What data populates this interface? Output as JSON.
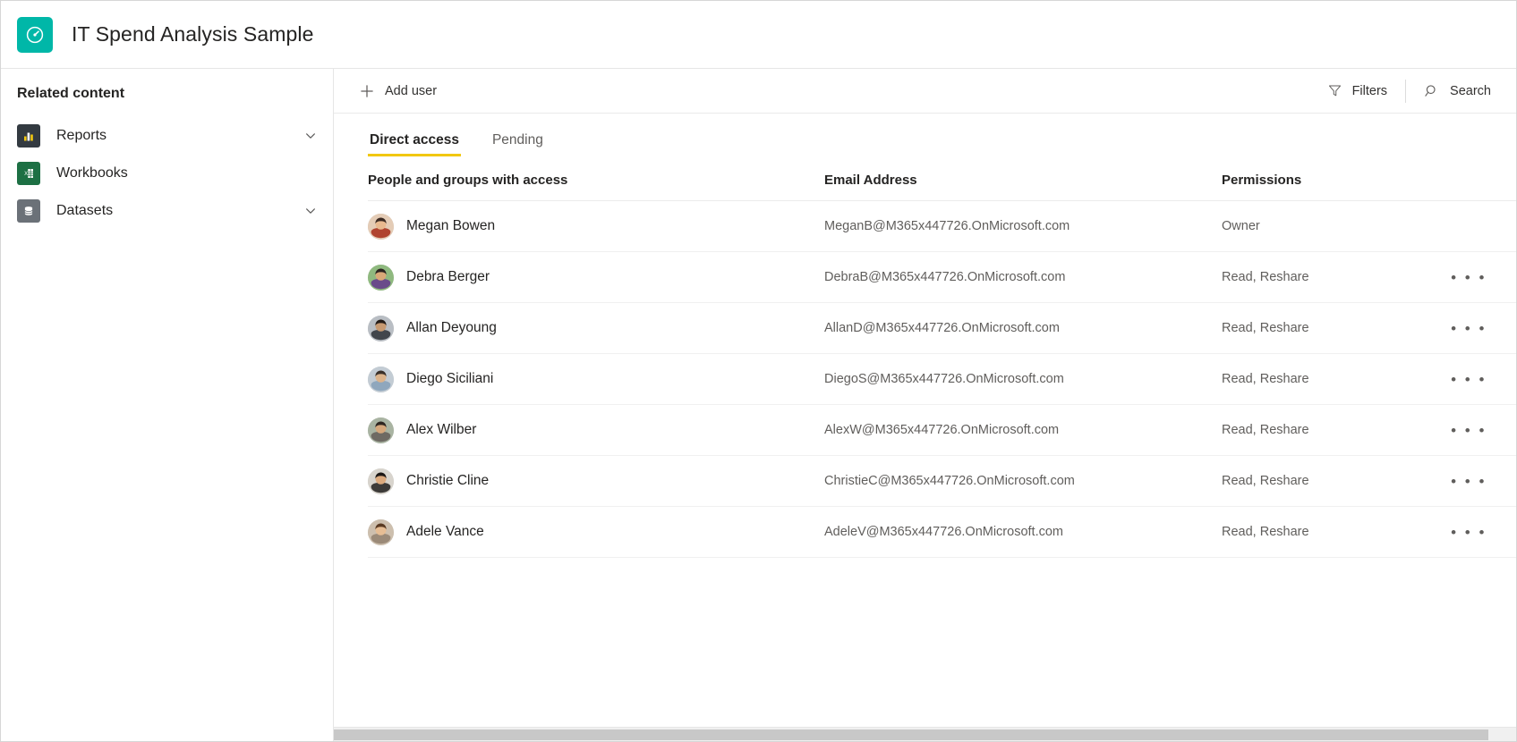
{
  "header": {
    "title": "IT Spend Analysis Sample",
    "icon": "gauge-icon",
    "icon_color": "#00b7a8"
  },
  "sidebar": {
    "title": "Related content",
    "items": [
      {
        "label": "Reports",
        "icon": "bar-chart-icon",
        "icon_color": "#333a41",
        "has_chevron": true
      },
      {
        "label": "Workbooks",
        "icon": "excel-workbook-icon",
        "icon_color": "#1d7044",
        "has_chevron": false
      },
      {
        "label": "Datasets",
        "icon": "database-icon",
        "icon_color": "#6b7178",
        "has_chevron": true
      }
    ]
  },
  "toolbar": {
    "add_user_label": "Add user",
    "add_user_icon": "plus-icon",
    "filters_label": "Filters",
    "filters_icon": "funnel-icon",
    "search_label": "Search",
    "search_icon": "magnifier-icon"
  },
  "tabs": {
    "active_underline_color": "#f2c811",
    "items": [
      {
        "label": "Direct access",
        "active": true
      },
      {
        "label": "Pending",
        "active": false
      }
    ]
  },
  "table": {
    "columns": {
      "person": "People and groups with access",
      "email": "Email Address",
      "permissions": "Permissions"
    },
    "overflow_label": "• • •",
    "rows": [
      {
        "name": "Megan Bowen",
        "email": "MeganB@M365x447726.OnMicrosoft.com",
        "permissions": "Owner",
        "has_menu": false,
        "avatar_colors": {
          "bg": "#e4ccb6",
          "hair": "#3b2a22",
          "skin": "#e8b98f",
          "shirt": "#b0432f"
        }
      },
      {
        "name": "Debra Berger",
        "email": "DebraB@M365x447726.OnMicrosoft.com",
        "permissions": "Read, Reshare",
        "has_menu": true,
        "avatar_colors": {
          "bg": "#8fb97f",
          "hair": "#2b2320",
          "skin": "#d9a878",
          "shirt": "#6a4a8a"
        }
      },
      {
        "name": "Allan Deyoung",
        "email": "AllanD@M365x447726.OnMicrosoft.com",
        "permissions": "Read, Reshare",
        "has_menu": true,
        "avatar_colors": {
          "bg": "#b9bec4",
          "hair": "#241c18",
          "skin": "#c79a72",
          "shirt": "#42464c"
        }
      },
      {
        "name": "Diego Siciliani",
        "email": "DiegoS@M365x447726.OnMicrosoft.com",
        "permissions": "Read, Reshare",
        "has_menu": true,
        "avatar_colors": {
          "bg": "#c3ccd4",
          "hair": "#3a3029",
          "skin": "#dcb48c",
          "shirt": "#8fa7bd"
        }
      },
      {
        "name": "Alex Wilber",
        "email": "AlexW@M365x447726.OnMicrosoft.com",
        "permissions": "Read, Reshare",
        "has_menu": true,
        "avatar_colors": {
          "bg": "#a9b4a2",
          "hair": "#2e2620",
          "skin": "#d5a87c",
          "shirt": "#6e6a63"
        }
      },
      {
        "name": "Christie Cline",
        "email": "ChristieC@M365x447726.OnMicrosoft.com",
        "permissions": "Read, Reshare",
        "has_menu": true,
        "avatar_colors": {
          "bg": "#d8d4cd",
          "hair": "#1c1714",
          "skin": "#dcaa7e",
          "shirt": "#3c3a38"
        }
      },
      {
        "name": "Adele Vance",
        "email": "AdeleV@M365x447726.OnMicrosoft.com",
        "permissions": "Read, Reshare",
        "has_menu": true,
        "avatar_colors": {
          "bg": "#cdbfae",
          "hair": "#5a3a22",
          "skin": "#e6bd94",
          "shirt": "#9b8a78"
        }
      }
    ]
  },
  "scrollbar": {
    "orientation": "horizontal"
  }
}
